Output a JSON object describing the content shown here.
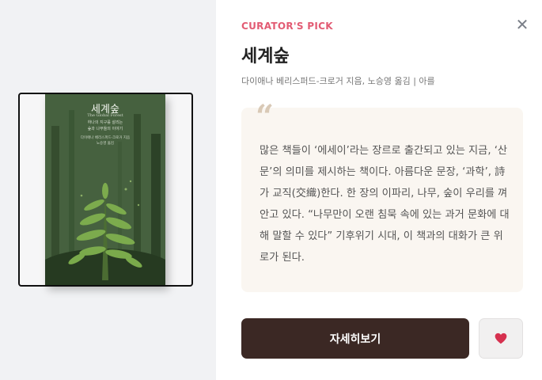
{
  "curator": {
    "label": "CURATOR'S PICK",
    "title": "세계숲",
    "meta": "다이애나 베리스퍼드-크로거 지음, 노승영 옮김 | 아를",
    "quote_mark": "“",
    "quote": "많은 책들이 ‘에세이’라는 장르로 출간되고 있는 지금, ‘산문’의 의미를 제시하는 책이다. 아름다운 문장, ‘과학’, 詩가 교직(交織)한다. 한 장의 이파리, 나무, 숲이 우리를 껴안고 있다. “나무만이 오랜 침묵 속에 있는 과거 문화에 대해 말할 수 있다” 기후위기 시대, 이 책과의 대화가 큰 위로가 된다.",
    "detail_button": "자세히보기",
    "close_icon": "close-icon",
    "like_icon": "heart-icon"
  },
  "book": {
    "cover_title": "세계숲",
    "cover_subtitle": "The Global Forest",
    "cover_desc": "하나의 지구를 살리는\n숲과 나무들의 이야기",
    "cover_author": "다이애나 베리스퍼드-크로거 지음\n노승영 옮김"
  },
  "colors": {
    "accent": "#e25b73",
    "button_bg": "#3b2824",
    "heart": "#d6314f",
    "quote_bg": "#faf6f1"
  }
}
